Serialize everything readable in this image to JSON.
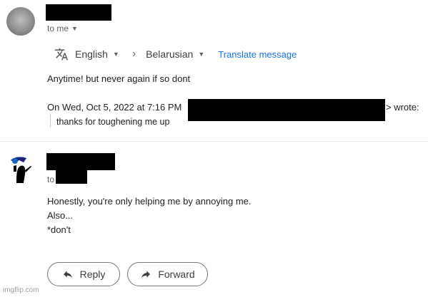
{
  "message1": {
    "to_label": "to me",
    "translate_bar": {
      "source_lang": "English",
      "target_lang": "Belarusian",
      "translate_link": "Translate message"
    },
    "body": "Anytime! but never again if so dont",
    "quote_prefix": "On Wed, Oct 5, 2022 at 7:16 PM",
    "quote_suffix": "> wrote:",
    "quoted_text": "thanks for toughening me up"
  },
  "message2": {
    "to_label": "to",
    "body_lines": [
      "Honestly, you're only helping me by annoying me.",
      "Also...",
      "*don't"
    ]
  },
  "actions": {
    "reply_label": "Reply",
    "forward_label": "Forward"
  },
  "watermark": "imgflip.com",
  "icons": {
    "translate": "translate-icon",
    "reply": "reply-arrow-icon",
    "forward": "forward-arrow-icon"
  },
  "colors": {
    "link": "#1a73e8",
    "redaction": "#000000"
  }
}
